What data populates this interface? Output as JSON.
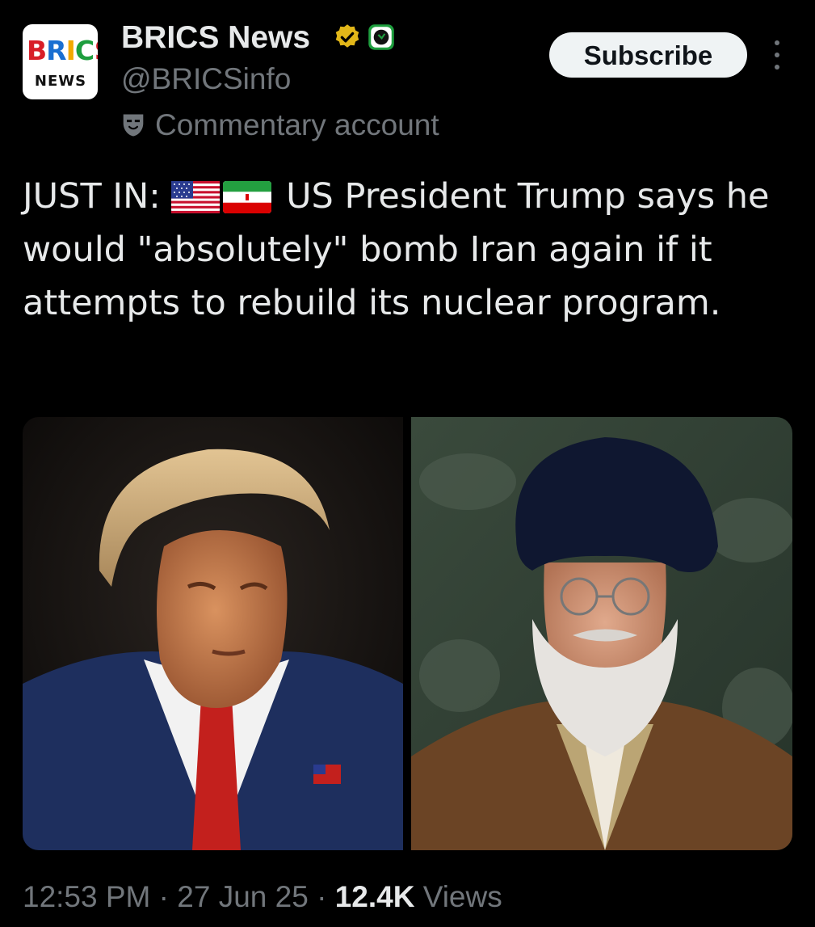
{
  "account": {
    "avatar_title": "BRICS",
    "avatar_subtitle": "NEWS",
    "display_name": "BRICS News",
    "handle": "@BRICSinfo",
    "label": "Commentary account",
    "subscribe_label": "Subscribe"
  },
  "tweet": {
    "prefix": "JUST IN:",
    "flags": [
      "us-flag-icon",
      "iran-flag-icon"
    ],
    "text_line1": "US President Trump",
    "text_rest": "says he would \"absolutely\" bomb Iran again if it attempts to rebuild its nuclear program."
  },
  "media": {
    "left_photo": "portrait-man-blue-suit",
    "right_photo": "portrait-man-black-turban"
  },
  "meta": {
    "time": "12:53 PM",
    "date": "27 Jun 25",
    "views_count": "12.4K",
    "views_label": "Views",
    "separator": "·"
  },
  "colors": {
    "background": "#000000",
    "text_primary": "#e7e9ea",
    "text_secondary": "#71767b",
    "verified_gold": "#e2b719",
    "subscribe_bg": "#eff3f4"
  }
}
